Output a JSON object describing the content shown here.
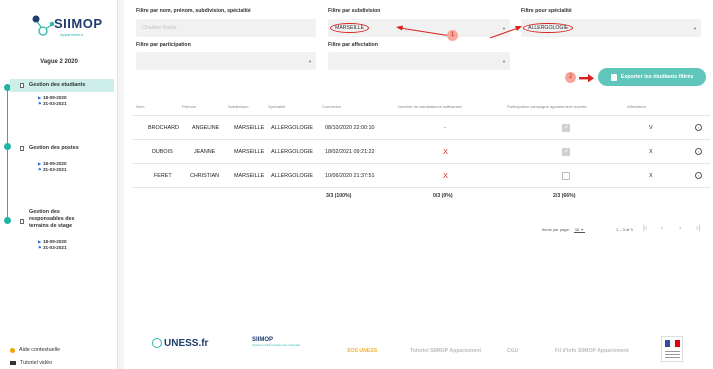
{
  "sidebar": {
    "logo_text": "SIIMOP",
    "logo_subtext": "Appariement",
    "wave": "Vague 2 2020",
    "sections": [
      {
        "label": "Gestion des etudiants",
        "date_start": "18-09-2020",
        "date_end": "31-03-2021"
      },
      {
        "label": "Gestion des postes",
        "date_start": "18-09-2020",
        "date_end": "31-03-2021"
      },
      {
        "label": "Gestion des responsables des terrains de stage",
        "date_start": "18-09-2020",
        "date_end": "31-03-2021"
      }
    ],
    "help_label": "Aide contextuelle",
    "video_label": "Tutoriel vidéo"
  },
  "filters": {
    "name_label": "Filtre par nom, prénom, subdivision, spécialité",
    "name_placeholder": "Charline Barbe",
    "subdivision_label": "Filtre par subdivision",
    "subdivision_value": "MARSEILLE",
    "specialty_label": "Filtre pour spécialité",
    "specialty_value": "ALLERGOLOGIE",
    "participation_label": "Filtre par participation",
    "participation_value": "",
    "affectation_label": "Filtre par affectation",
    "affectation_value": ""
  },
  "annotations": {
    "marker_1": "1",
    "marker_2": "2",
    "color": "#d92020"
  },
  "export_label": "Exporter les étudiants filtrés",
  "table": {
    "columns": [
      "Nom",
      "Prénom",
      "Subdivision",
      "Spécialité",
      "Connexion",
      "Nombre de candidatures suffisantes",
      "Participation campagne appariement ouverte",
      "Affectation"
    ],
    "rows": [
      {
        "nom": "BROCHARD",
        "prenom": "ANGELINE",
        "subdivision": "MARSEILLE",
        "specialite": "ALLERGOLOGIE",
        "connexion": "08/10/2020 22:00:10",
        "candidatures": "-",
        "participation": true,
        "affectation": "V"
      },
      {
        "nom": "DUBOIS",
        "prenom": "JEANNE",
        "subdivision": "MARSEILLE",
        "specialite": "ALLERGOLOGIE",
        "connexion": "18/02/2021 09:21:22",
        "candidatures": "X",
        "participation": true,
        "affectation": "X"
      },
      {
        "nom": "FERET",
        "prenom": "CHRISTIAN",
        "subdivision": "MARSEILLE",
        "specialite": "ALLERGOLOGIE",
        "connexion": "10/06/2020 21:37:51",
        "candidatures": "X",
        "participation": false,
        "affectation": "X"
      }
    ],
    "totals": {
      "connexion": "3/3 (100%)",
      "candidatures": "0/3 (0%)",
      "participation": "2/3 (66%)"
    }
  },
  "pagination": {
    "items_per_page_label": "Items per page:",
    "items_per_page": "10",
    "range": "1 – 3 of 3"
  },
  "footer": {
    "uness": "UNESS.fr",
    "siimop": "SIIMOP",
    "siimop_sub": "Système d'Information des Internats",
    "links": [
      "SOS UNESS",
      "Tutoriel SIIMOP Appariement",
      "CGU",
      "Fil d'info SIIMOP Appariement"
    ]
  }
}
